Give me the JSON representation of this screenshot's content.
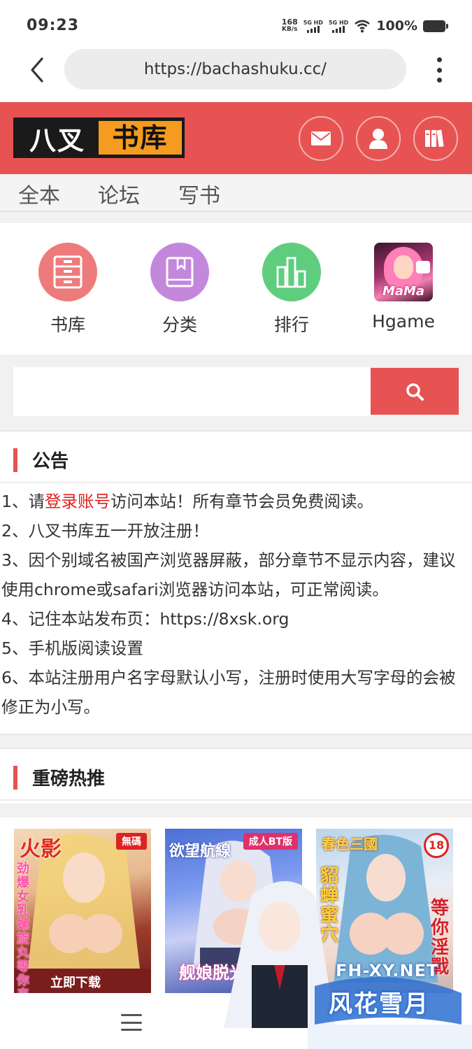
{
  "status_bar": {
    "time": "09:23",
    "net_speed_value": "168",
    "net_speed_unit": "KB/s",
    "sim1": "5G HD",
    "sim2": "5G HD",
    "battery": "100%"
  },
  "browser": {
    "url": "https://bachashuku.cc/"
  },
  "site": {
    "logo_part1": "八叉",
    "logo_part2": "书库",
    "brand_color": "#e75353",
    "accent_color": "#f59b1f"
  },
  "nav": {
    "items": [
      "全本",
      "论坛",
      "写书"
    ]
  },
  "quick_links": [
    {
      "label": "书库",
      "icon": "bookshelf-icon",
      "color": "#ee7b7b"
    },
    {
      "label": "分类",
      "icon": "book-icon",
      "color": "#c387dc"
    },
    {
      "label": "排行",
      "icon": "bar-chart-icon",
      "color": "#5fcd7e"
    },
    {
      "label": "Hgame",
      "icon": "hgame-thumbnail",
      "thumb_text": "MaMa"
    }
  ],
  "search": {
    "placeholder": "",
    "button_icon": "search-icon"
  },
  "announcement": {
    "title": "公告",
    "lines": [
      {
        "prefix": "1、请",
        "link": "登录账号",
        "suffix": "访问本站！所有章节会员免费阅读。"
      },
      {
        "text": "2、八叉书库五一开放注册！"
      },
      {
        "text": "3、因个别域名被国产浏览器屏蔽，部分章节不显示内容，建议使用chrome或safari浏览器访问本站，可正常阅读。"
      },
      {
        "text": "4、记住本站发布页：https://8xsk.org"
      },
      {
        "text": "5、手机版阅读设置"
      },
      {
        "text": "6、本站注册用户名字母默认小写，注册时使用大写字母的会被修正为小写。"
      }
    ]
  },
  "featured": {
    "title": "重磅热推",
    "covers": [
      {
        "badge": "無碼",
        "title": "火影",
        "side_text": "劲爆女乳螺旋丸等你来",
        "bottom_text": "立即下载"
      },
      {
        "badge": "成人BT版",
        "title": "欲望航線",
        "bottom_text": "舰娘脱光"
      },
      {
        "badge": "18",
        "title": "春色三國",
        "side_text": "貂蝉蜜穴",
        "right_text": "等你淫戰"
      }
    ]
  },
  "watermark": {
    "line1": "FH-XY.NET",
    "line2": "风花雪月"
  }
}
